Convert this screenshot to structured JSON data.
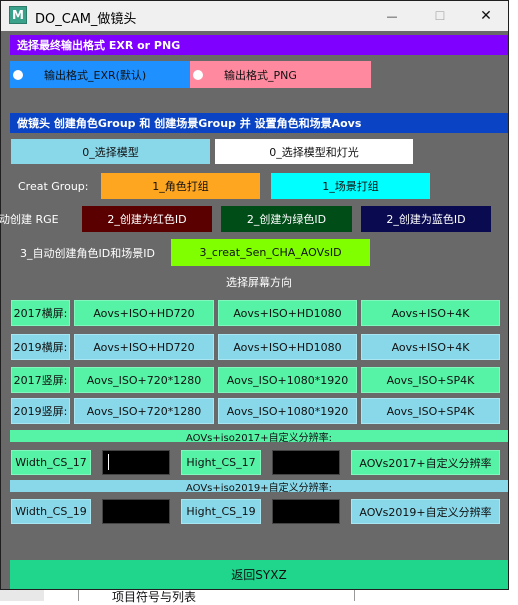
{
  "window": {
    "title": "DO_CAM_做镜头",
    "app_icon_letter": "M",
    "minimize": "—",
    "maximize": "☐",
    "close": "✕"
  },
  "output_format": {
    "header": "选择最终输出格式 EXR or PNG",
    "exr_label": "输出格式_EXR(默认)",
    "png_label": "输出格式_PNG"
  },
  "camera_section": {
    "header": "做镜头   创建角色Group 和 创建场景Group 并 设置角色和场景Aovs",
    "select_model": "0_选择模型",
    "select_model_lights": "0_选择模型和灯光",
    "creat_group_label": "Creat Group:",
    "character_group": "1_角色打组",
    "scene_group": "1_场景打组",
    "rge_label": "手动创建 RGE",
    "red_id": "2_创建为红色ID",
    "green_id": "2_创建为绿色ID",
    "blue_id": "2_创建为蓝色ID",
    "auto_label": "3_自动创建角色ID和场景ID",
    "auto_button": "3_creat_Sen_CHA_AOVsID"
  },
  "orientation_label": "选择屏幕方向",
  "presets": [
    {
      "row": "2017横屏:",
      "a": "Aovs+ISO+HD720",
      "b": "Aovs+ISO+HD1080",
      "c": "Aovs+ISO+4K"
    },
    {
      "row": "2019横屏:",
      "a": "Aovs+ISO+HD720",
      "b": "Aovs+ISO+HD1080",
      "c": "Aovs+ISO+4K"
    },
    {
      "row": "2017竖屏:",
      "a": "Aovs_ISO+720*1280",
      "b": "Aovs_ISO+1080*1920",
      "c": "Aovs_ISO+SP4K"
    },
    {
      "row": "2019竖屏:",
      "a": "Aovs_ISO+720*1280",
      "b": "Aovs_ISO+1080*1920",
      "c": "Aovs_ISO+SP4K"
    }
  ],
  "custom2017": {
    "header": "AOVs+iso2017+自定义分辨率:",
    "width_label": "Width_CS_17",
    "width_value": "",
    "height_label": "Hight_CS_17",
    "height_value": "",
    "apply": "AOVs2017+自定义分辨率"
  },
  "custom2019": {
    "header": "AOVs+iso2019+自定义分辨率:",
    "width_label": "Width_CS_19",
    "width_value": "",
    "height_label": "Hight_CS_19",
    "height_value": "",
    "apply": "AOVs2019+自定义分辨率"
  },
  "back_button": "返回SYXZ",
  "background_text": "项目符号与列表",
  "colors": {
    "header_purple": "#8000ff",
    "header_blue": "#0a44c4",
    "exr_blue": "#1e90ff",
    "png_pink": "#ff8aa0",
    "orange": "#ffa620",
    "cyan": "#00ffff",
    "dark_red": "#5a0000",
    "dark_green": "#004d18",
    "dark_navy": "#0a0a50",
    "lime": "#7fff00",
    "teal": "#56f2a6",
    "sky": "#89d8ea",
    "back_green": "#1fd68c"
  }
}
